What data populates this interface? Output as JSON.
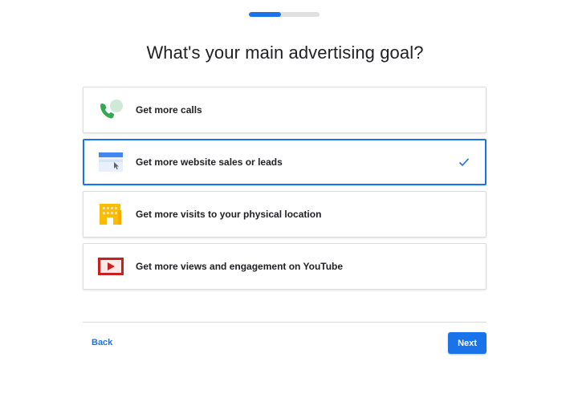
{
  "progress": {
    "fraction": 0.45
  },
  "title": "What's your main advertising goal?",
  "options": [
    {
      "label": "Get more calls",
      "icon": "phone-icon",
      "selected": false
    },
    {
      "label": "Get more website sales or leads",
      "icon": "browser-window-icon",
      "selected": true
    },
    {
      "label": "Get more visits to your physical location",
      "icon": "building-icon",
      "selected": false
    },
    {
      "label": "Get more views and engagement on YouTube",
      "icon": "youtube-play-icon",
      "selected": false
    }
  ],
  "footer": {
    "back_label": "Back",
    "next_label": "Next"
  },
  "colors": {
    "accent": "#1a73e8",
    "border": "#dadce0",
    "text": "#202124",
    "phone_green": "#34a853",
    "building_yellow": "#fbbc04",
    "youtube_red": "#c5221f"
  }
}
